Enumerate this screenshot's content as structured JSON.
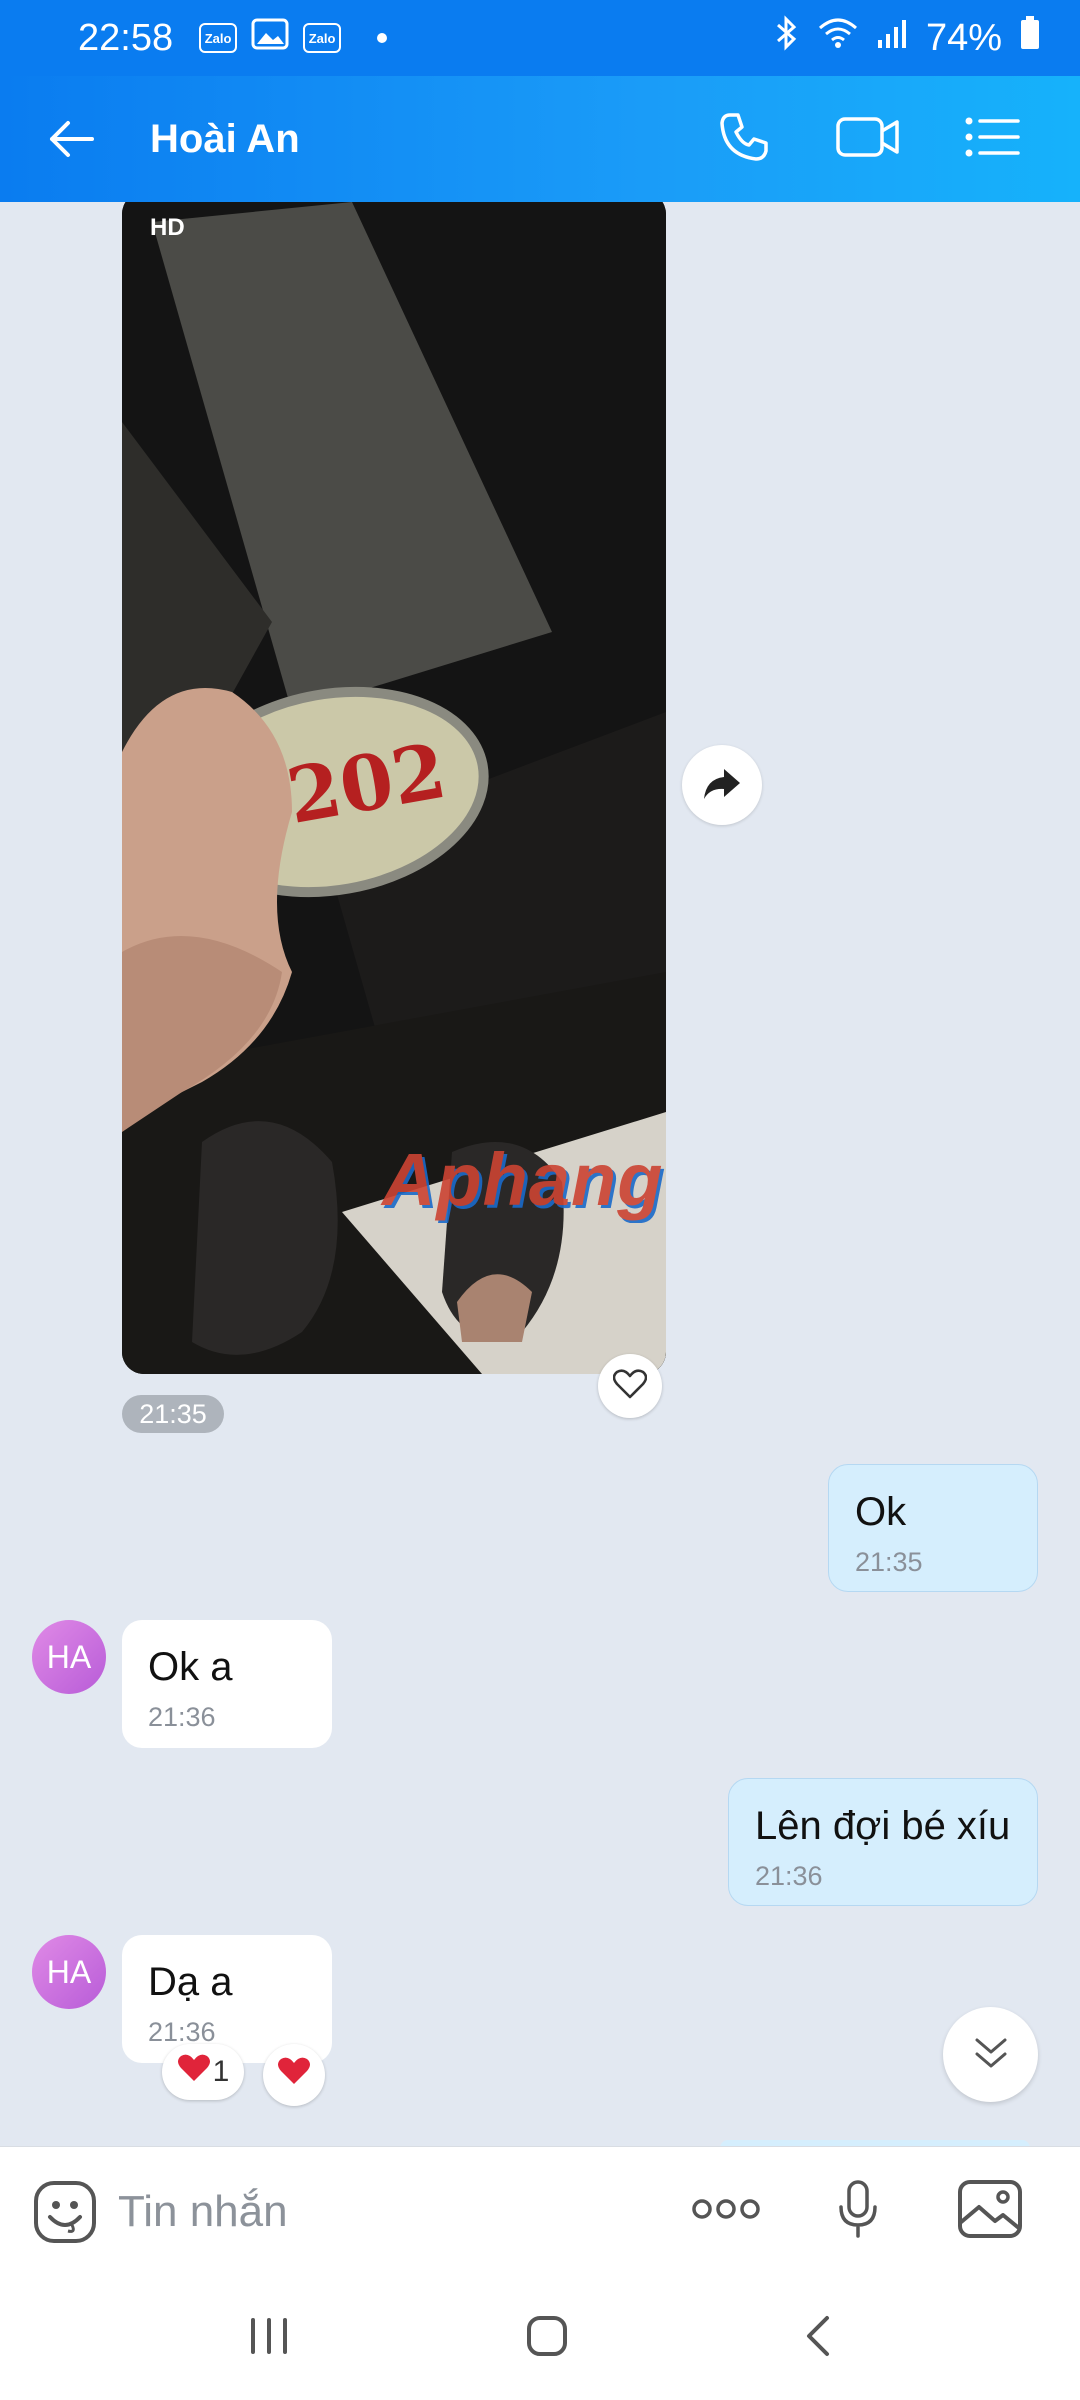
{
  "status_bar": {
    "time": "22:58",
    "app_icon_label": "Zalo",
    "battery": "74%"
  },
  "header": {
    "contact_name": "Hoài An"
  },
  "photo": {
    "badge": "HD",
    "sign_text": "P.202",
    "watermark": "Aphang",
    "time": "21:35"
  },
  "messages": [
    {
      "dir": "out",
      "text": "Ok",
      "time": "21:35"
    },
    {
      "dir": "in",
      "avatar": "HA",
      "text": "Ok a",
      "time": "21:36"
    },
    {
      "dir": "out",
      "text": "Lên đợi bé xíu",
      "time": "21:36"
    },
    {
      "dir": "in",
      "avatar": "HA",
      "text": "Dạ a",
      "time": "21:36"
    }
  ],
  "reactions": {
    "summary_count": "1"
  },
  "composer": {
    "placeholder": "Tin nhắn"
  },
  "colors": {
    "header": "#0a7cf0",
    "outgoing_bubble": "#d5eefd",
    "chat_bg": "#e2e8f1"
  },
  "icons": [
    "back-arrow-icon",
    "phone-icon",
    "video-call-icon",
    "menu-list-icon",
    "share-icon",
    "heart-icon",
    "double-chevron-down-icon",
    "sticker-icon",
    "more-icon",
    "mic-icon",
    "gallery-icon"
  ]
}
